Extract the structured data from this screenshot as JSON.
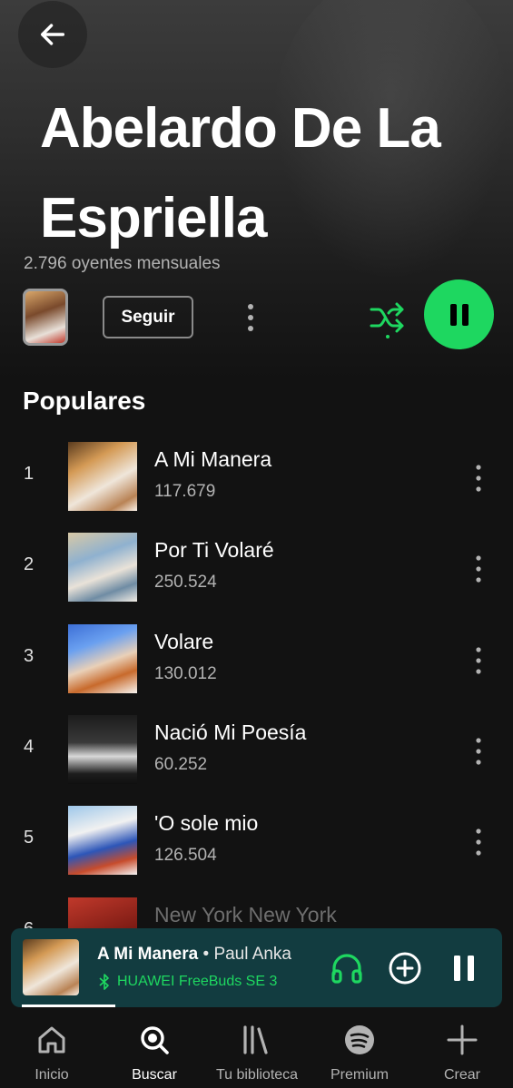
{
  "artist": {
    "name": "Abelardo De La Espriella",
    "monthly_listeners": "2.796 oyentes mensuales"
  },
  "actions": {
    "follow_label": "Seguir"
  },
  "popular": {
    "section_title": "Populares",
    "tracks": [
      {
        "rank": "1",
        "title": "A Mi Manera",
        "plays": "117.679"
      },
      {
        "rank": "2",
        "title": "Por Ti Volaré",
        "plays": "250.524"
      },
      {
        "rank": "3",
        "title": "Volare",
        "plays": "130.012"
      },
      {
        "rank": "4",
        "title": "Nació Mi Poesía",
        "plays": "60.252"
      },
      {
        "rank": "5",
        "title": "'O sole mio",
        "plays": "126.504"
      },
      {
        "rank": "6",
        "title": "New York New York",
        "plays": ""
      }
    ]
  },
  "now_playing": {
    "song": "A Mi Manera",
    "separator": " • ",
    "artist": "Paul Anka",
    "device": "HUAWEI FreeBuds SE 3",
    "progress_fraction": 0.2
  },
  "tabs": [
    {
      "label": "Inicio",
      "icon": "home-icon"
    },
    {
      "label": "Buscar",
      "icon": "search-icon"
    },
    {
      "label": "Tu biblioteca",
      "icon": "library-icon"
    },
    {
      "label": "Premium",
      "icon": "spotify-icon"
    },
    {
      "label": "Crear",
      "icon": "plus-icon"
    }
  ],
  "colors": {
    "accent": "#1ed760",
    "background": "#121212",
    "mini_player": "#123c40"
  }
}
